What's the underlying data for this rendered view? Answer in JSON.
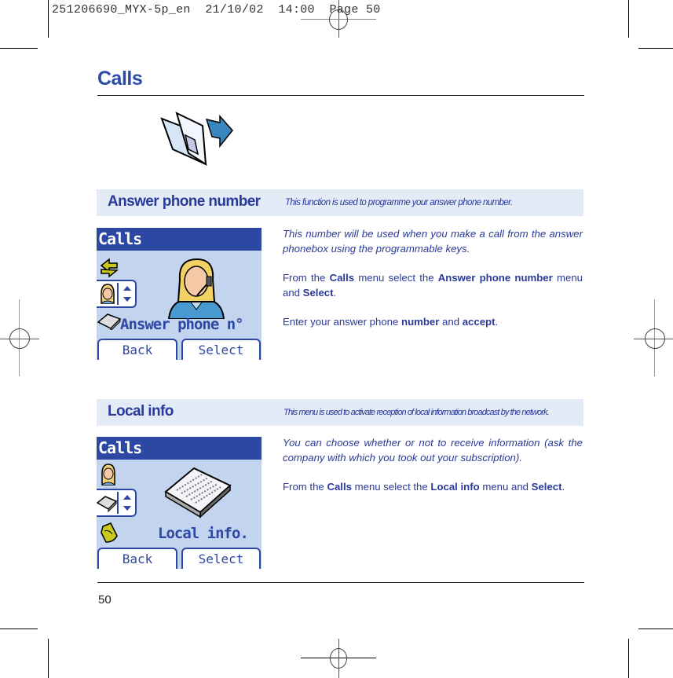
{
  "print_slug": "251206690_MYX-5p_en  21/10/02  14:00  Page 50",
  "page": {
    "title": "Calls",
    "number": "50",
    "icon": "calls-folder-icon"
  },
  "sections": [
    {
      "title": "Answer phone number",
      "description": "This function is used to programme your answer phone number.",
      "screen": {
        "header": "Calls",
        "label": "Answer phone n°",
        "icons": [
          "divert-arrows-icon",
          "operator-headset-icon",
          "notepad-icon"
        ],
        "main_icon": "operator-headset-icon",
        "softkeys": [
          "Back",
          "Select"
        ]
      },
      "intro": "This number will be used when you make a call from the answer phonebox using the programmable keys.",
      "steps": [
        {
          "parts": [
            "From the ",
            {
              "b": "Calls"
            },
            " menu select the ",
            {
              "b": "Answer phone number"
            },
            " menu and ",
            {
              "b": "Select"
            },
            "."
          ]
        },
        {
          "parts": [
            "Enter your answer phone ",
            {
              "b": "number"
            },
            " and ",
            {
              "b": "accept"
            },
            "."
          ]
        }
      ]
    },
    {
      "title": "Local info",
      "description": "This menu is used to activate reception of local information broadcast by the network.",
      "screen": {
        "header": "Calls",
        "label": "Local info.",
        "icons": [
          "operator-headset-icon",
          "notepad-icon",
          "bell-icon"
        ],
        "main_icon": "notepad-icon",
        "softkeys": [
          "Back",
          "Select"
        ]
      },
      "intro": "You can choose whether or not to receive information (ask the company with which you took out your subscription).",
      "steps": [
        {
          "parts": [
            "From the ",
            {
              "b": "Calls"
            },
            " menu select the ",
            {
              "b": "Local info"
            },
            " menu and ",
            {
              "b": "Select"
            },
            "."
          ]
        }
      ]
    }
  ],
  "colors": {
    "accent": "#2a3a99",
    "title": "#2a4ba8",
    "section_bg": "#e3ebf7",
    "screen_bg": "#c3d5ee",
    "screen_header": "#2d48a3"
  }
}
